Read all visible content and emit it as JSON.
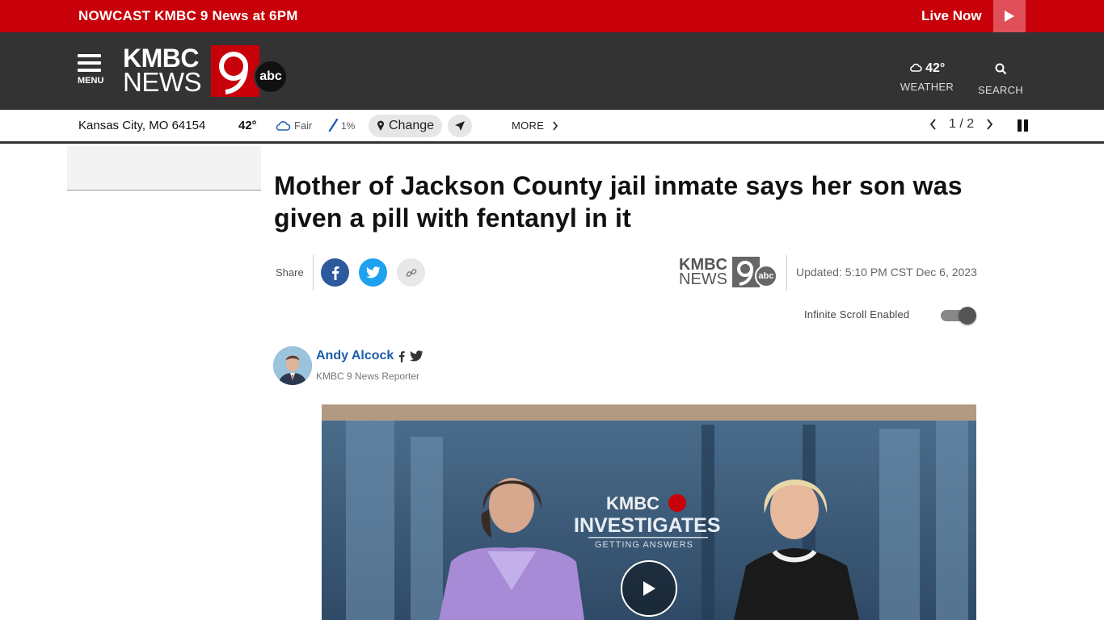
{
  "banner": {
    "nowcast_prefix": "NOWCAST",
    "nowcast_title": "KMBC 9 News at 6PM",
    "live_label": "Live Now"
  },
  "header": {
    "menu_label": "MENU",
    "logo_line1": "KMBC",
    "logo_line2": "NEWS",
    "logo_abc": "abc",
    "weather_temp": "42°",
    "weather_label": "WEATHER",
    "search_label": "SEARCH"
  },
  "location_bar": {
    "city": "Kansas City, MO 64154",
    "temp": "42°",
    "condition": "Fair",
    "precip": "1%",
    "change_label": "Change",
    "more_label": "MORE",
    "pager": "1 / 2"
  },
  "article": {
    "headline": "Mother of Jackson County jail inmate says her son was given a pill with fentanyl in it",
    "share_label": "Share",
    "source_logo_line1": "KMBC",
    "source_logo_line2": "NEWS",
    "source_logo_abc": "abc",
    "updated": "Updated: 5:10 PM CST Dec 6, 2023",
    "infinite_scroll_label": "Infinite Scroll Enabled",
    "infinite_scroll_on": true,
    "author_name": "Andy Alcock",
    "author_role": "KMBC 9 News Reporter"
  },
  "video": {
    "overlay_brand": "KMBC",
    "overlay_title": "INVESTIGATES",
    "overlay_subtitle": "GETTING ANSWERS"
  },
  "colors": {
    "brand_red": "#c8000a",
    "header_dark": "#333333",
    "facebook": "#2d5a9e",
    "twitter": "#1ea1f1",
    "author_link": "#1d5fa8"
  }
}
